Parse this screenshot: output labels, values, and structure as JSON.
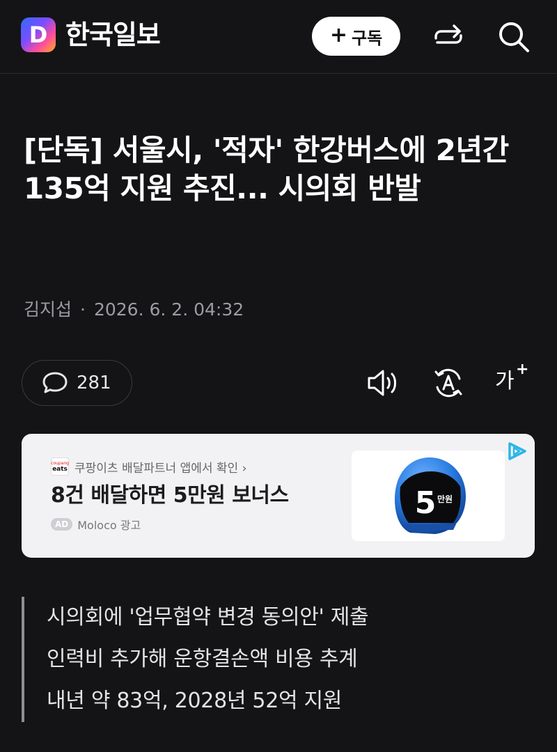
{
  "header": {
    "logo_letter": "D",
    "brand": "한국일보",
    "subscribe_plus": "+",
    "subscribe_label": "구독",
    "share_icon": "share-icon",
    "search_icon": "search-icon"
  },
  "article": {
    "title": "[단독] 서울시, '적자' 한강버스에 2년간 135억 지원 추진... 시의회 반발",
    "author": "김지섭",
    "separator": "·",
    "date": "2026. 6. 2. 04:32"
  },
  "toolbar": {
    "comment_count": "281",
    "speaker_icon": "speaker-icon",
    "translate_icon": "translate-icon",
    "font_size_label": "가",
    "font_size_plus": "+"
  },
  "ad": {
    "logo_top": "coupang",
    "logo_bottom": "eats",
    "source_text": "쿠팡이츠 배달파트너 앱에서 확인 ›",
    "headline": "8건 배달하면 5만원 보너스",
    "badge": "AD",
    "advertiser": "Moloco 광고",
    "helmet_number": "5",
    "helmet_unit": "만원",
    "accent_color": "#2a7de1"
  },
  "summary": {
    "lines": [
      "시의회에 '업무협약 변경 동의안' 제출",
      "인력비 추가해 운항결손액 비용 추계",
      "내년 약 83억, 2028년 52억 지원"
    ]
  }
}
